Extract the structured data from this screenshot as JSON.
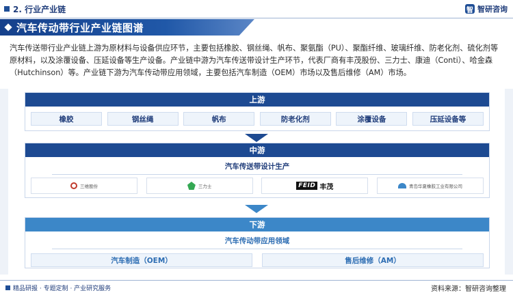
{
  "header": {
    "section_title": "2. 行业产业链",
    "brand_name": "智研咨询",
    "brand_mark": "智"
  },
  "banner": {
    "title": "汽车传动带行业产业链图谱"
  },
  "intro": {
    "text": "汽车传送带行业产业链上游为原材料与设备供应环节，主要包括橡胶、钢丝绳、帆布、聚氨酯（PU）、聚酯纤维、玻璃纤维、防老化剂、硫化剂等原材料，以及涂覆设备、压延设备等生产设备。产业链中游为汽车传送带设计生产环节，代表厂商有丰茂股份、三力士、康迪（Conti）、哈金森（Hutchinson）等。产业链下游为汽车传动带应用领域，主要包括汽车制造（OEM）市场以及售后维修（AM）市场。"
  },
  "upstream": {
    "title": "上游",
    "items": [
      "橡胶",
      "钢丝绳",
      "帆布",
      "防老化剂",
      "涂覆设备",
      "压延设备等"
    ]
  },
  "midstream": {
    "title": "中游",
    "subtitle": "汽车传送带设计生产",
    "logos": [
      {
        "name": "三维股份",
        "icon": "red-circle-logo"
      },
      {
        "name": "三力士",
        "icon": "green-mark-logo"
      },
      {
        "name": "FEID 丰茂",
        "icon": "feid-logo"
      },
      {
        "name": "青岛华夏橡胶工业有限公司",
        "icon": "blue-mark-logo"
      }
    ],
    "feid_en": "FEID",
    "feid_cn": "丰茂"
  },
  "downstream": {
    "title": "下游",
    "subtitle": "汽车传动带应用领域",
    "items": [
      "汽车制造（OEM）",
      "售后维修（AM）"
    ]
  },
  "footer": {
    "left": "精品研报 · 专题定制 · 产业研究服务",
    "right": "资料来源：智研咨询整理"
  },
  "colors": {
    "primary": "#1d4a92",
    "secondary": "#3c87c8",
    "chip_bg": "#eef4fb"
  }
}
